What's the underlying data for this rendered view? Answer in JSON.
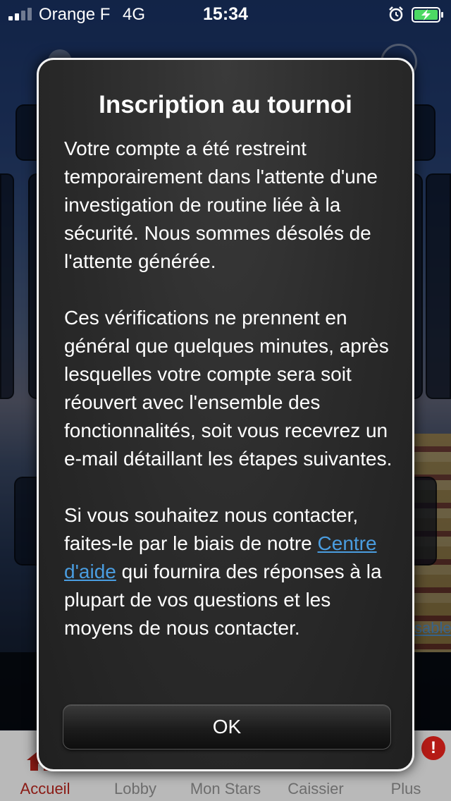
{
  "status_bar": {
    "carrier": "Orange F",
    "network": "4G",
    "time": "15:34",
    "icons": [
      "signal-icon",
      "alarm-icon",
      "battery-charging-icon"
    ],
    "battery_color": "#4cd964"
  },
  "background": {
    "link_fragment": "sable"
  },
  "modal": {
    "title": "Inscription au tournoi",
    "paragraph1": "Votre compte a été restreint temporairement dans l'attente d'une investigation de routine liée à la sécurité. Nous sommes désolés de l'attente générée.",
    "paragraph2": "Ces vérifications ne prennent en général que quelques minutes, après lesquelles votre compte sera soit réouvert avec l'ensemble des fonctionnalités, soit vous recevrez un e-mail détaillant les étapes suivantes.",
    "paragraph3_before": "Si vous souhaitez nous contacter, faites-le par le biais de notre ",
    "paragraph3_link": "Centre d'aide",
    "paragraph3_after": " qui fournira des réponses à la plupart de vos questions et les moyens de nous contacter.",
    "ok_label": "OK",
    "link_color": "#4a9de0"
  },
  "tabbar": {
    "items": [
      {
        "label": "Accueil",
        "icon": "home-icon",
        "active": true
      },
      {
        "label": "Lobby",
        "active": false
      },
      {
        "label": "Mon Stars",
        "active": false
      },
      {
        "label": "Caissier",
        "active": false
      },
      {
        "label": "Plus",
        "active": false,
        "badge": "!"
      }
    ],
    "active_color": "#8a1a14"
  }
}
